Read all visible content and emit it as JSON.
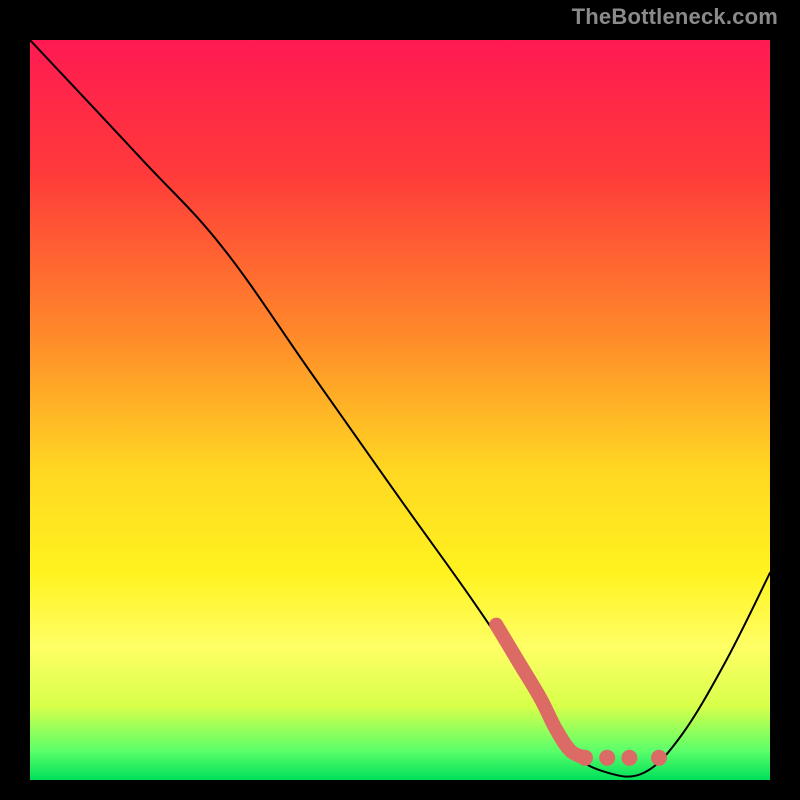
{
  "watermark": "TheBottleneck.com",
  "chart_data": {
    "type": "line",
    "title": "",
    "xlabel": "",
    "ylabel": "",
    "xlim": [
      0,
      100
    ],
    "ylim": [
      0,
      100
    ],
    "grid": false,
    "background_gradient": {
      "stops": [
        {
          "offset": 0,
          "color": "#ff1a52"
        },
        {
          "offset": 18,
          "color": "#ff3a3a"
        },
        {
          "offset": 40,
          "color": "#ff8a2a"
        },
        {
          "offset": 58,
          "color": "#ffd722"
        },
        {
          "offset": 72,
          "color": "#fff31f"
        },
        {
          "offset": 82,
          "color": "#ffff66"
        },
        {
          "offset": 90,
          "color": "#d8ff4a"
        },
        {
          "offset": 96,
          "color": "#5cff6a"
        },
        {
          "offset": 100,
          "color": "#00e05a"
        }
      ]
    },
    "series": [
      {
        "name": "bottleneck-curve",
        "stroke": "#000000",
        "stroke_width": 2,
        "points": [
          {
            "x": 0,
            "y": 100
          },
          {
            "x": 15,
            "y": 84
          },
          {
            "x": 26,
            "y": 72
          },
          {
            "x": 38,
            "y": 55
          },
          {
            "x": 50,
            "y": 38
          },
          {
            "x": 60,
            "y": 24
          },
          {
            "x": 68,
            "y": 12
          },
          {
            "x": 73,
            "y": 4
          },
          {
            "x": 78,
            "y": 1
          },
          {
            "x": 83,
            "y": 1
          },
          {
            "x": 88,
            "y": 6
          },
          {
            "x": 94,
            "y": 16
          },
          {
            "x": 100,
            "y": 28
          }
        ]
      },
      {
        "name": "highlight-band",
        "stroke": "#dc6b66",
        "stroke_width": 14,
        "points": [
          {
            "x": 63,
            "y": 21
          },
          {
            "x": 66,
            "y": 16
          },
          {
            "x": 69,
            "y": 11
          },
          {
            "x": 71,
            "y": 7
          },
          {
            "x": 73,
            "y": 4
          },
          {
            "x": 75,
            "y": 3
          }
        ]
      }
    ],
    "dots": {
      "name": "highlight-dots",
      "fill": "#dc6b66",
      "r": 8,
      "points": [
        {
          "x": 75,
          "y": 3
        },
        {
          "x": 78,
          "y": 3
        },
        {
          "x": 81,
          "y": 3
        },
        {
          "x": 85,
          "y": 3
        }
      ]
    }
  }
}
